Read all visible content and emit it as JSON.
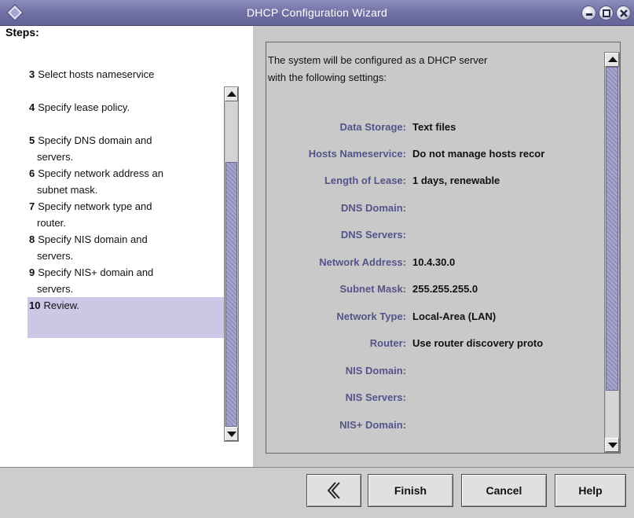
{
  "window": {
    "title": "DHCP Configuration Wizard",
    "icon": "diamond-icon",
    "controls": [
      "minimize-icon",
      "maximize-icon",
      "close-icon"
    ]
  },
  "steps": {
    "heading": "Steps:",
    "items": [
      {
        "num": "3",
        "line1": "Select hosts nameservice",
        "line2": "",
        "active": false
      },
      {
        "num": "4",
        "line1": "Specify lease policy.",
        "line2": "",
        "active": false
      },
      {
        "num": "5",
        "line1": "Specify DNS domain and",
        "line2": "servers.",
        "active": false
      },
      {
        "num": "6",
        "line1": "Specify network address an",
        "line2": "subnet mask.",
        "active": false
      },
      {
        "num": "7",
        "line1": "Specify network type and",
        "line2": "router.",
        "active": false
      },
      {
        "num": "8",
        "line1": "Specify NIS domain and",
        "line2": "servers.",
        "active": false
      },
      {
        "num": "9",
        "line1": "Specify NIS+ domain and",
        "line2": "servers.",
        "active": false
      },
      {
        "num": "10",
        "line1": "Review.",
        "line2": "",
        "active": true
      }
    ]
  },
  "review": {
    "intro_line1": "The system will be configured as a DHCP server",
    "intro_line2": "with the following settings:",
    "rows": [
      {
        "label": "Data Storage:",
        "value": "Text files"
      },
      {
        "label": "Hosts Nameservice:",
        "value": "Do not manage hosts recor"
      },
      {
        "label": "Length of Lease:",
        "value": "1 days, renewable"
      },
      {
        "label": "DNS Domain:",
        "value": ""
      },
      {
        "label": "DNS Servers:",
        "value": ""
      },
      {
        "label": "Network Address:",
        "value": "10.4.30.0"
      },
      {
        "label": "Subnet Mask:",
        "value": "255.255.255.0"
      },
      {
        "label": "Network Type:",
        "value": "Local-Area (LAN)"
      },
      {
        "label": "Router:",
        "value": "Use router discovery proto"
      },
      {
        "label": "NIS Domain:",
        "value": ""
      },
      {
        "label": "NIS Servers:",
        "value": ""
      },
      {
        "label": "NIS+ Domain:",
        "value": ""
      }
    ]
  },
  "buttons": {
    "back_icon": "chevron-left-icon",
    "finish": "Finish",
    "cancel": "Cancel",
    "help": "Help"
  },
  "colors": {
    "titlebar": "#6f6fa4",
    "label": "#54548a",
    "selected_step": "#cbc8e6"
  }
}
